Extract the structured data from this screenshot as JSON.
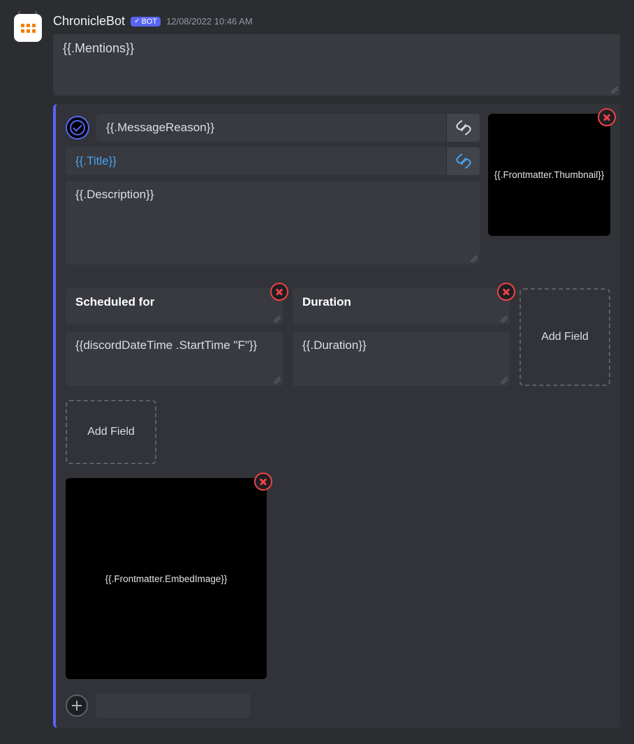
{
  "header": {
    "username": "ChronicleBot",
    "bot_label": "BOT",
    "timestamp": "12/08/2022 10:46 AM"
  },
  "mentions": "{{.Mentions}}",
  "embed": {
    "author": {
      "value": "{{.MessageReason}}"
    },
    "title": {
      "value": "{{.Title}}"
    },
    "description": "{{.Description}}",
    "thumbnail": "{{.Frontmatter.Thumbnail}}",
    "image": "{{.Frontmatter.EmbedImage}}",
    "fields": [
      {
        "name": "Scheduled for",
        "value": "{{discordDateTime .StartTime \"F\"}}"
      },
      {
        "name": "Duration",
        "value": "{{.Duration}}"
      }
    ],
    "add_field_label": "Add Field"
  }
}
